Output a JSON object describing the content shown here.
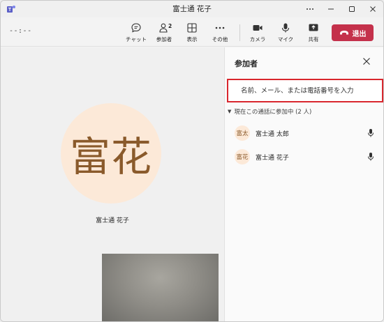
{
  "window": {
    "title": "富士通 花子",
    "controls": [
      "more-icon",
      "minimize-icon",
      "maximize-icon",
      "close-icon"
    ]
  },
  "toolbar": {
    "timer": "--:--",
    "buttons": [
      {
        "label": "チャット",
        "icon": "chat-icon"
      },
      {
        "label": "参加者",
        "icon": "people-icon",
        "badge": "2"
      },
      {
        "label": "表示",
        "icon": "grid-icon"
      },
      {
        "label": "その他",
        "icon": "more-icon"
      },
      {
        "label": "カメラ",
        "icon": "camera-icon"
      },
      {
        "label": "マイク",
        "icon": "mic-icon"
      },
      {
        "label": "共有",
        "icon": "share-icon"
      }
    ],
    "leave_label": "退出",
    "leave_color": "#c4314b"
  },
  "stage": {
    "avatar_initials": "富花",
    "name": "富士通 花子",
    "avatar_bg": "#fce9d8",
    "avatar_text_color": "#8a5a2b"
  },
  "panel": {
    "title": "参加者",
    "search_placeholder": "名前、メール、または電話番号を入力",
    "search_value": "",
    "highlight_color": "#d9262d",
    "section_label": "現在この通話に参加中 (2 人)",
    "participants": [
      {
        "initials": "富太",
        "name": "富士通 太郎"
      },
      {
        "initials": "富花",
        "name": "富士通 花子"
      }
    ]
  }
}
